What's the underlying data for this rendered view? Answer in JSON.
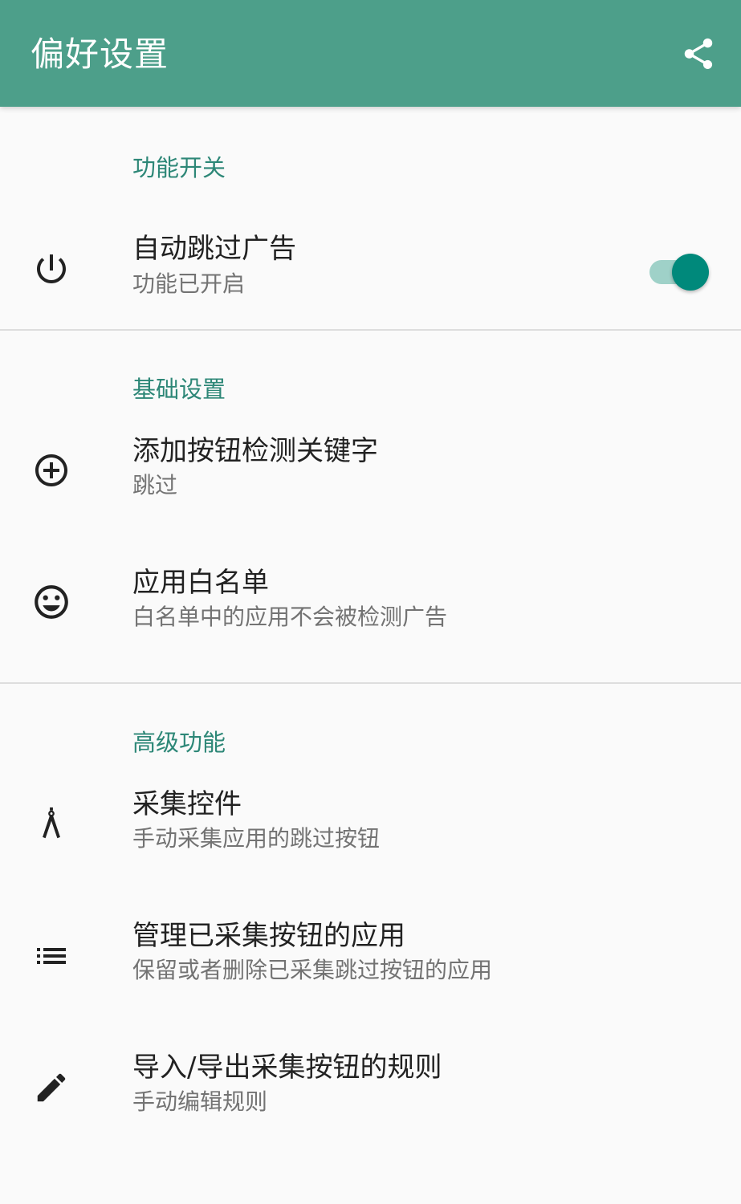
{
  "toolbar": {
    "title": "偏好设置",
    "share_icon": "share-icon",
    "background_color": "#4d9f8a"
  },
  "sections": {
    "feature_switch": {
      "header": "功能开关",
      "auto_skip": {
        "title": "自动跳过广告",
        "summary": "功能已开启",
        "icon": "power-icon",
        "enabled": true
      }
    },
    "basic_settings": {
      "header": "基础设置",
      "add_keyword": {
        "title": "添加按钮检测关键字",
        "summary": "跳过",
        "icon": "add-circle-icon"
      },
      "whitelist": {
        "title": "应用白名单",
        "summary": "白名单中的应用不会被检测广告",
        "icon": "smiley-icon"
      }
    },
    "advanced": {
      "header": "高级功能",
      "collect_widgets": {
        "title": "采集控件",
        "summary": "手动采集应用的跳过按钮",
        "icon": "compass-icon"
      },
      "manage_apps": {
        "title": "管理已采集按钮的应用",
        "summary": "保留或者删除已采集跳过按钮的应用",
        "icon": "list-icon"
      },
      "import_export": {
        "title": "导入/导出采集按钮的规则",
        "summary": "手动编辑规则",
        "icon": "pencil-icon"
      }
    }
  },
  "colors": {
    "accent": "#2d8777",
    "switch_thumb": "#00897b",
    "switch_track": "#9fd1c8"
  }
}
